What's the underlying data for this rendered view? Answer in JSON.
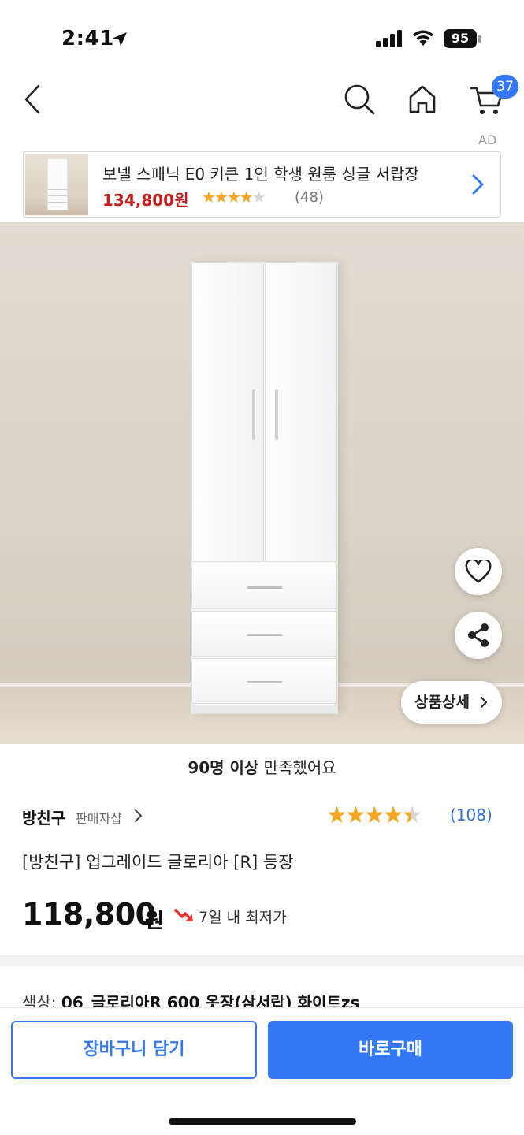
{
  "status_bar": {
    "time": "2:41",
    "battery": "95"
  },
  "header": {
    "cart_count": "37"
  },
  "ad": {
    "label": "AD",
    "title": "보넬 스패닉 E0 키큰 1인 학생 원룸 싱글 서랍장",
    "price": "134,800원",
    "stars": "★★★★",
    "stars_empty": "★",
    "review_count": "(48)"
  },
  "product_image": {
    "detail_button_label": "상품상세"
  },
  "satisfaction": {
    "bold": "90명 이상",
    "rest": " 만족했어요"
  },
  "seller": {
    "name": "방친구",
    "shop_link": "판매자샵"
  },
  "rating": {
    "value": 4.5,
    "stars_full": "★★★★",
    "star_half": "★",
    "count": "(108)"
  },
  "product": {
    "title": "[방친구] 업그레이드 글로리아 [R] 등장",
    "price": "118,800",
    "price_unit": "원",
    "lowest_price_text": "7일 내 최저가"
  },
  "option": {
    "label": "색상: ",
    "value": "06_글로리아R 600 옷장(삼서랍) 화이트zs"
  },
  "actions": {
    "add_to_cart": "장바구니 담기",
    "buy_now": "바로구매"
  },
  "colors": {
    "accent": "#3478f6",
    "ad_price": "#c21e1e",
    "star": "#f5a623",
    "rating_count": "#3a6fd8"
  }
}
